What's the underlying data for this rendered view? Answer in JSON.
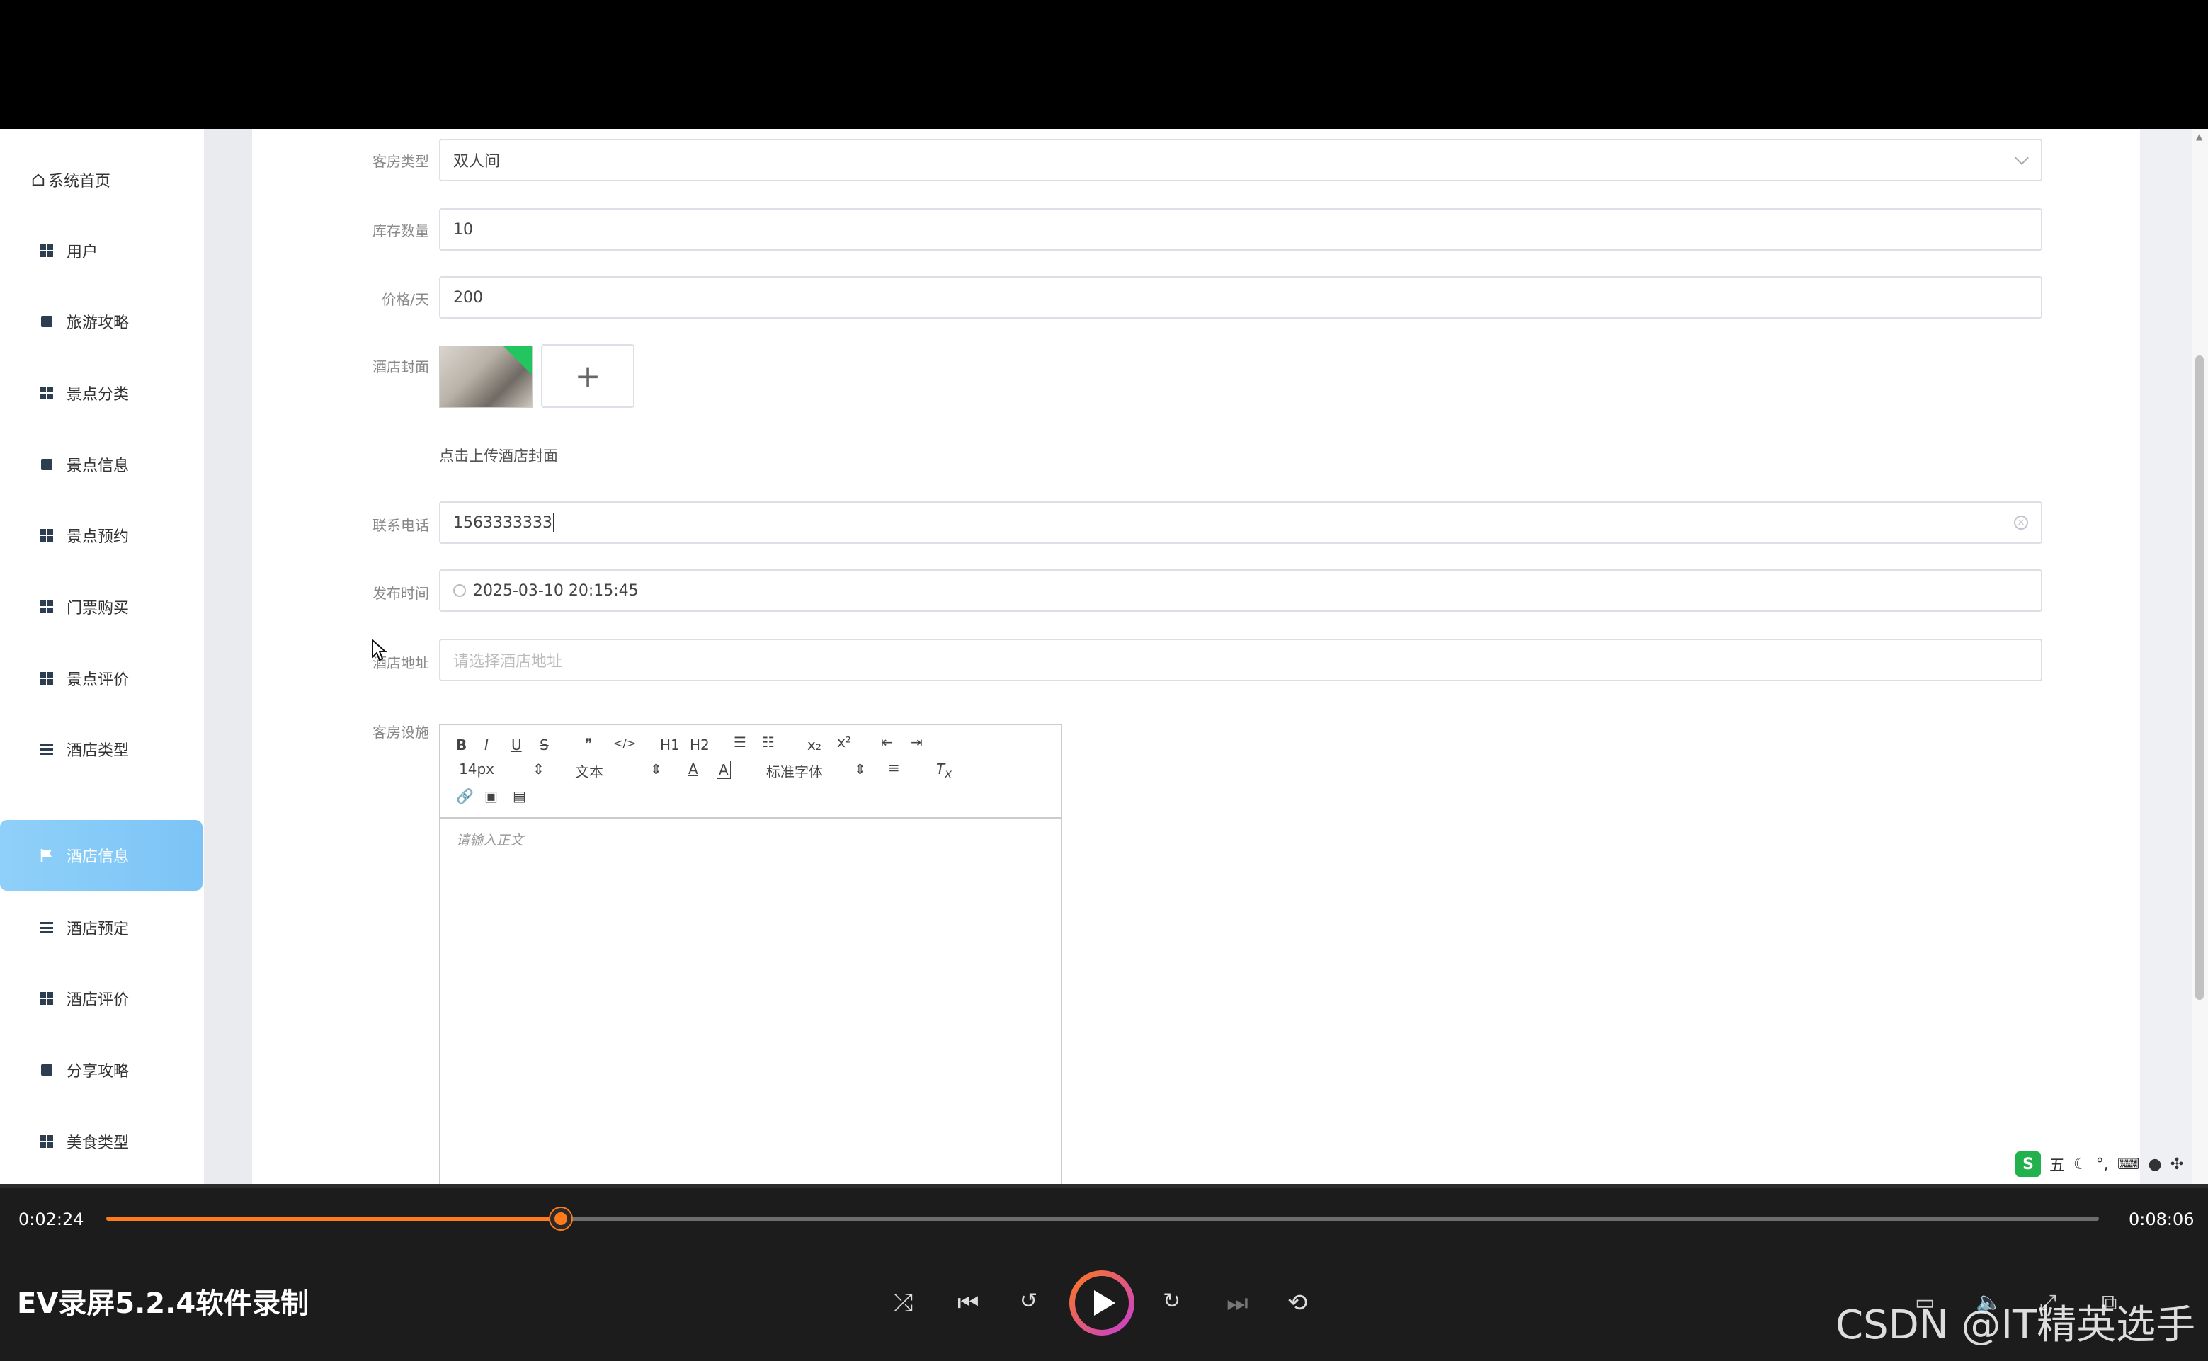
{
  "sidebar": {
    "items": [
      {
        "label": "系统首页",
        "icon": "home-icon"
      },
      {
        "label": "用户",
        "icon": "grid-icon"
      },
      {
        "label": "旅游攻略",
        "icon": "book-icon"
      },
      {
        "label": "景点分类",
        "icon": "grid-icon"
      },
      {
        "label": "景点信息",
        "icon": "clipboard-icon"
      },
      {
        "label": "景点预约",
        "icon": "grid-icon"
      },
      {
        "label": "门票购买",
        "icon": "grid-icon"
      },
      {
        "label": "景点评价",
        "icon": "grid-icon"
      },
      {
        "label": "酒店类型",
        "icon": "list-icon"
      },
      {
        "label": "酒店信息",
        "icon": "flag-icon"
      },
      {
        "label": "酒店预定",
        "icon": "list-icon"
      },
      {
        "label": "酒店评价",
        "icon": "grid-icon"
      },
      {
        "label": "分享攻略",
        "icon": "thumb-icon"
      },
      {
        "label": "美食类型",
        "icon": "grid-icon"
      }
    ],
    "active": "酒店信息"
  },
  "form": {
    "room_type_label": "客房类型",
    "room_type_value": "双人间",
    "stock_label": "库存数量",
    "stock_value": "10",
    "price_label": "价格/天",
    "price_value": "200",
    "cover_label": "酒店封面",
    "cover_tip": "点击上传酒店封面",
    "upload_plus": "+",
    "phone_label": "联系电话",
    "phone_value": "1563333333",
    "publish_label": "发布时间",
    "publish_value": "2025-03-10 20:15:45",
    "address_label": "酒店地址",
    "address_placeholder": "请选择酒店地址",
    "facilities_label": "客房设施"
  },
  "editor": {
    "font_size": "14px",
    "block_type": "文本",
    "font_family": "标准字体",
    "placeholder": "请输入正文",
    "h1": "H1",
    "h2": "H2"
  },
  "player": {
    "current_time": "0:02:24",
    "total_time": "0:08:06",
    "progress": 0.228,
    "title": "EV录屏5.2.4软件录制",
    "watermark": "CSDN @IT精英选手"
  },
  "ime": {
    "mode": "五"
  }
}
